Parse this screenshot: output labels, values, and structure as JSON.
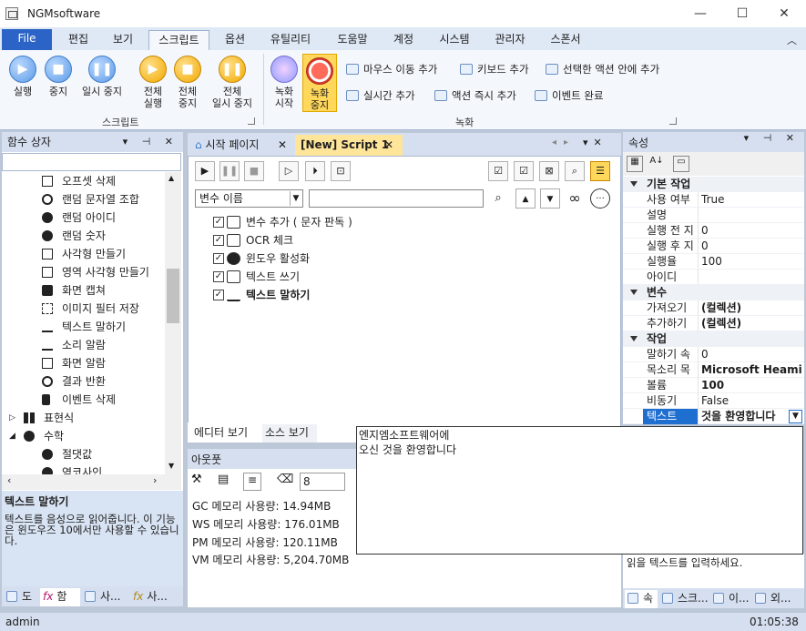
{
  "window": {
    "title": "NGMsoftware"
  },
  "menu": {
    "file": "File",
    "tabs": [
      "편집",
      "보기",
      "스크립트",
      "옵션",
      "유틸리티",
      "도움말",
      "계정",
      "시스템",
      "관리자",
      "스폰서"
    ],
    "active": "스크립트"
  },
  "ribbon": {
    "script_group": {
      "label": "스크립트",
      "buttons": [
        "실행",
        "중지",
        "일시 중지"
      ],
      "all_buttons": [
        [
          "전체",
          "실행"
        ],
        [
          "전체",
          "중지"
        ],
        [
          "전체",
          "일시 중지"
        ]
      ]
    },
    "record_group": {
      "label": "녹화",
      "rec_start": [
        "녹화",
        "시작"
      ],
      "rec_stop": [
        "녹화",
        "중지"
      ],
      "actions": [
        "마우스 이동 추가",
        "키보드 추가",
        "선택한 액션 안에 추가",
        "실시간 추가",
        "액션 즉시 추가",
        "이벤트 완료"
      ]
    }
  },
  "left_panel": {
    "title": "함수 상자",
    "items": [
      {
        "label": "오프셋 삭제",
        "icon": "square-icon"
      },
      {
        "label": "랜덤 문자열 조합",
        "icon": "share-icon"
      },
      {
        "label": "랜덤 아이디",
        "icon": "share-icon"
      },
      {
        "label": "랜덤 숫자",
        "icon": "share-icon"
      },
      {
        "label": "사각형 만들기",
        "icon": "rectangle-icon"
      },
      {
        "label": "영역 사각형 만들기",
        "icon": "edit-icon"
      },
      {
        "label": "화면 캡쳐",
        "icon": "camera-icon"
      },
      {
        "label": "이미지 필터 저장",
        "icon": "filter-icon"
      },
      {
        "label": "텍스트 말하기",
        "icon": "wave-icon"
      },
      {
        "label": "소리 알람",
        "icon": "wave-icon"
      },
      {
        "label": "화면 알람",
        "icon": "monitor-icon"
      },
      {
        "label": "결과 반환",
        "icon": "return-icon"
      },
      {
        "label": "이벤트 삭제",
        "icon": "trash-icon"
      }
    ],
    "groups": [
      {
        "label": "표현식",
        "expanded": false
      },
      {
        "label": "수학",
        "expanded": true
      }
    ],
    "sub_items": [
      "절댓값",
      "역코사인"
    ],
    "desc_title": "텍스트 말하기",
    "desc_text": "텍스트를 음성으로 읽어줍니다. 이 기능은 윈도우즈 10에서만 사용할 수 있습니다.",
    "bottom_tabs": [
      "도",
      "함",
      "사...",
      "사..."
    ]
  },
  "document": {
    "tabs": [
      {
        "label": "시작 페이지",
        "active": false
      },
      {
        "label": "[New] Script 1",
        "active": true
      }
    ],
    "var_select": "변수 이름",
    "actions": [
      {
        "label": "변수 추가 ( 문자 판독 )",
        "checked": true,
        "bold": false
      },
      {
        "label": "OCR 체크",
        "checked": true,
        "bold": false
      },
      {
        "label": "윈도우 활성화",
        "checked": true,
        "bold": false
      },
      {
        "label": "텍스트 쓰기",
        "checked": true,
        "bold": false
      },
      {
        "label": "텍스트 말하기",
        "checked": true,
        "bold": true
      }
    ],
    "bottom_tabs": [
      "에디터 보기",
      "소스 보기"
    ]
  },
  "output": {
    "title": "아웃풋",
    "font_size": "8",
    "lines": [
      "GC 메모리 사용량: 14.94MB",
      "WS 메모리 사용량: 176.01MB",
      "PM 메모리 사용량: 120.11MB",
      "VM 메모리 사용량: 5,204.70MB"
    ]
  },
  "properties": {
    "title": "속성",
    "categories": [
      {
        "name": "기본 작업",
        "rows": [
          {
            "name": "사용 여부",
            "value": "True"
          },
          {
            "name": "설명",
            "value": ""
          },
          {
            "name": "실행 전 지",
            "value": "0"
          },
          {
            "name": "실행 후 지",
            "value": "0"
          },
          {
            "name": "실행율",
            "value": "100"
          },
          {
            "name": "아이디",
            "value": ""
          }
        ]
      },
      {
        "name": "변수",
        "rows": [
          {
            "name": "가져오기",
            "value": "(컬렉션)"
          },
          {
            "name": "추가하기",
            "value": "(컬렉션)"
          }
        ]
      },
      {
        "name": "작업",
        "rows": [
          {
            "name": "말하기 속",
            "value": "0"
          },
          {
            "name": "목소리 목",
            "value": "Microsoft Heami"
          },
          {
            "name": "볼륨",
            "value": "100"
          },
          {
            "name": "비동기",
            "value": "False"
          },
          {
            "name": "텍스트",
            "value": "것을 환영합니다"
          }
        ]
      }
    ],
    "desc_text": "읽을 텍스트를 입력하세요.",
    "bottom_tabs": [
      "속",
      "스크...",
      "이...",
      "외..."
    ]
  },
  "popup": {
    "lines": [
      "엔지엠소프트웨어에",
      "오신 것을 환영합니다"
    ]
  },
  "status": {
    "user": "admin",
    "time": "01:05:38"
  }
}
